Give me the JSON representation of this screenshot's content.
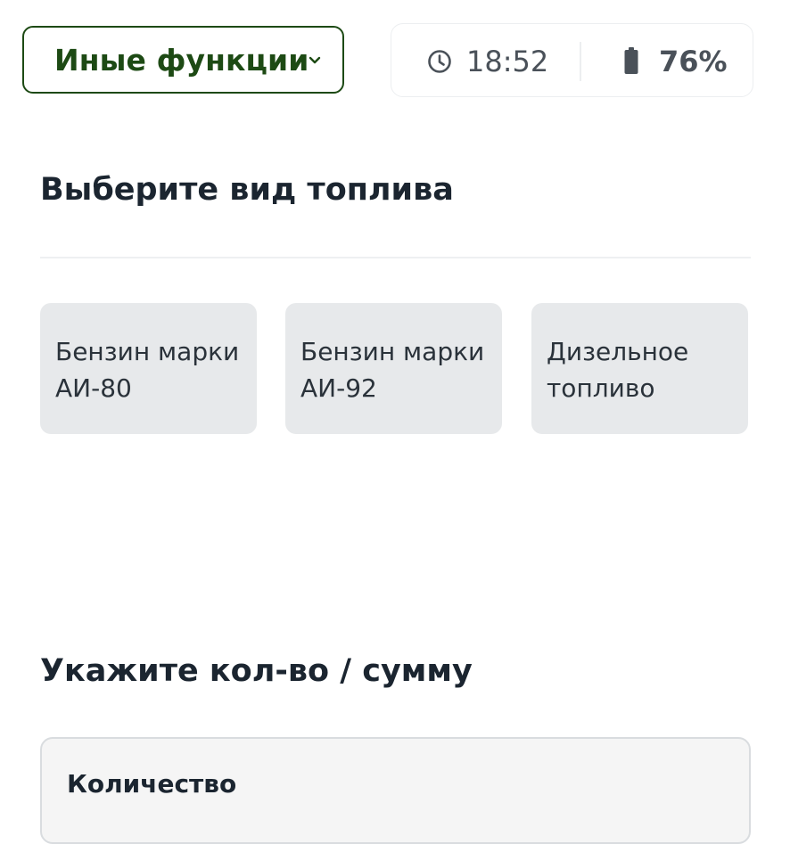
{
  "header": {
    "menu_label": "Иные функции",
    "time": "18:52",
    "battery": "76%"
  },
  "fuel": {
    "title": "Выберите вид топлива",
    "options": [
      {
        "line1": "Бензин марки",
        "line2": "АИ-80"
      },
      {
        "line1": "Бензин марки",
        "line2": "АИ-92"
      },
      {
        "line1": "Дизельное",
        "line2": "топливо"
      }
    ]
  },
  "quantity": {
    "title": "Укажите кол-во / сумму",
    "field_label": "Количество"
  },
  "colors": {
    "accent": "#1d4a14",
    "card": "#e7e9eb",
    "text": "#1b2530"
  }
}
